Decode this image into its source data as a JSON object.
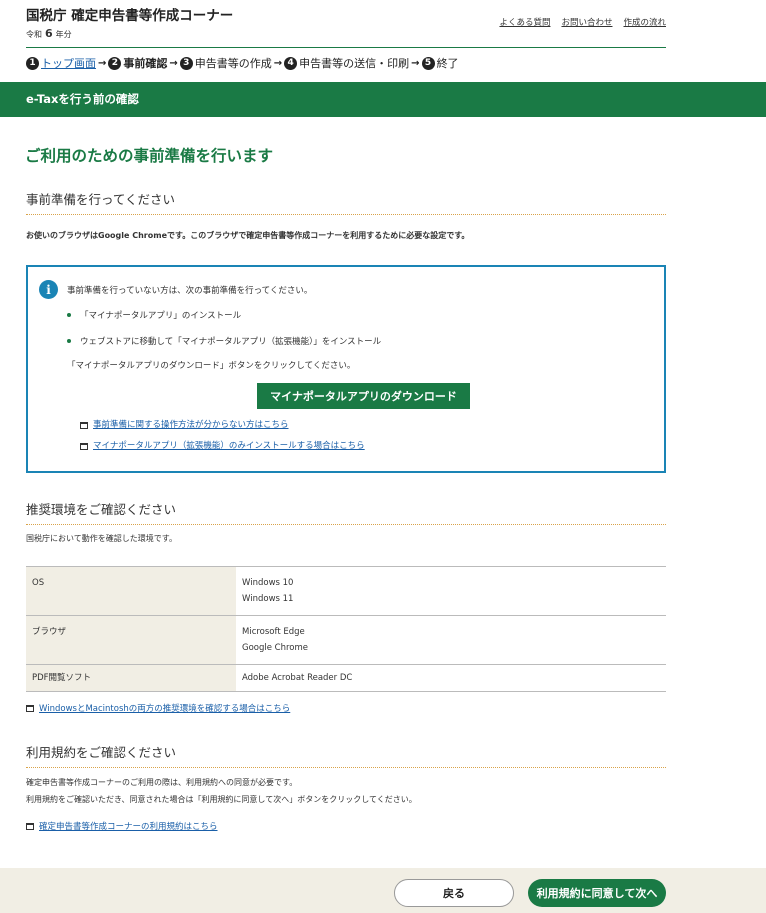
{
  "header": {
    "title": "国税庁 確定申告書等作成コーナー",
    "era_prefix": "令和",
    "era_year": "6",
    "era_suffix": "年分",
    "links": [
      "よくある質問",
      "お問い合わせ",
      "作成の流れ"
    ]
  },
  "steps": [
    {
      "num": "1",
      "label": "トップ画面"
    },
    {
      "num": "2",
      "label": "事前確認"
    },
    {
      "num": "3",
      "label": "申告書等の作成"
    },
    {
      "num": "4",
      "label": "申告書等の送信・印刷"
    },
    {
      "num": "5",
      "label": "終了"
    }
  ],
  "band_title": "e-Taxを行う前の確認",
  "main_title": "ご利用のための事前準備を行います",
  "prep": {
    "heading": "事前準備を行ってください",
    "browser_note": "お使いのブラウザはGoogle Chromeです。このブラウザで確定申告書等作成コーナーを利用するために必要な設定です。",
    "info": {
      "icon": "info-icon",
      "intro": "事前準備を行っていない方は、次の事前準備を行ってください。",
      "items": [
        "「マイナポータルアプリ」のインストール",
        "ウェブストアに移動して「マイナポータルアプリ（拡張機能）」をインストール"
      ],
      "instruction": "「マイナポータルアプリのダウンロード」ボタンをクリックしてください。",
      "download_button": "マイナポータルアプリのダウンロード",
      "links": [
        "事前準備に関する操作方法が分からない方はこちら",
        "マイナポータルアプリ（拡張機能）のみインストールする場合はこちら"
      ]
    }
  },
  "env": {
    "heading": "推奨環境をご確認ください",
    "note": "国税庁において動作を確認した環境です。",
    "rows": [
      {
        "label": "OS",
        "values": [
          "Windows 10",
          "Windows 11"
        ]
      },
      {
        "label": "ブラウザ",
        "values": [
          "Microsoft Edge",
          "Google Chrome"
        ]
      },
      {
        "label": "PDF閲覧ソフト",
        "values": [
          "Adobe Acrobat Reader DC"
        ]
      }
    ],
    "link": "WindowsとMacintoshの両方の推奨環境を確認する場合はこちら"
  },
  "terms": {
    "heading": "利用規約をご確認ください",
    "line1": "確定申告書等作成コーナーのご利用の際は、利用規約への同意が必要です。",
    "line2": "利用規約をご確認いただき、同意された場合は「利用規約に同意して次へ」ボタンをクリックしてください。",
    "link": "確定申告書等作成コーナーの利用規約はこちら"
  },
  "footer": {
    "back_label": "戻る",
    "next_label": "利用規約に同意して次へ"
  }
}
